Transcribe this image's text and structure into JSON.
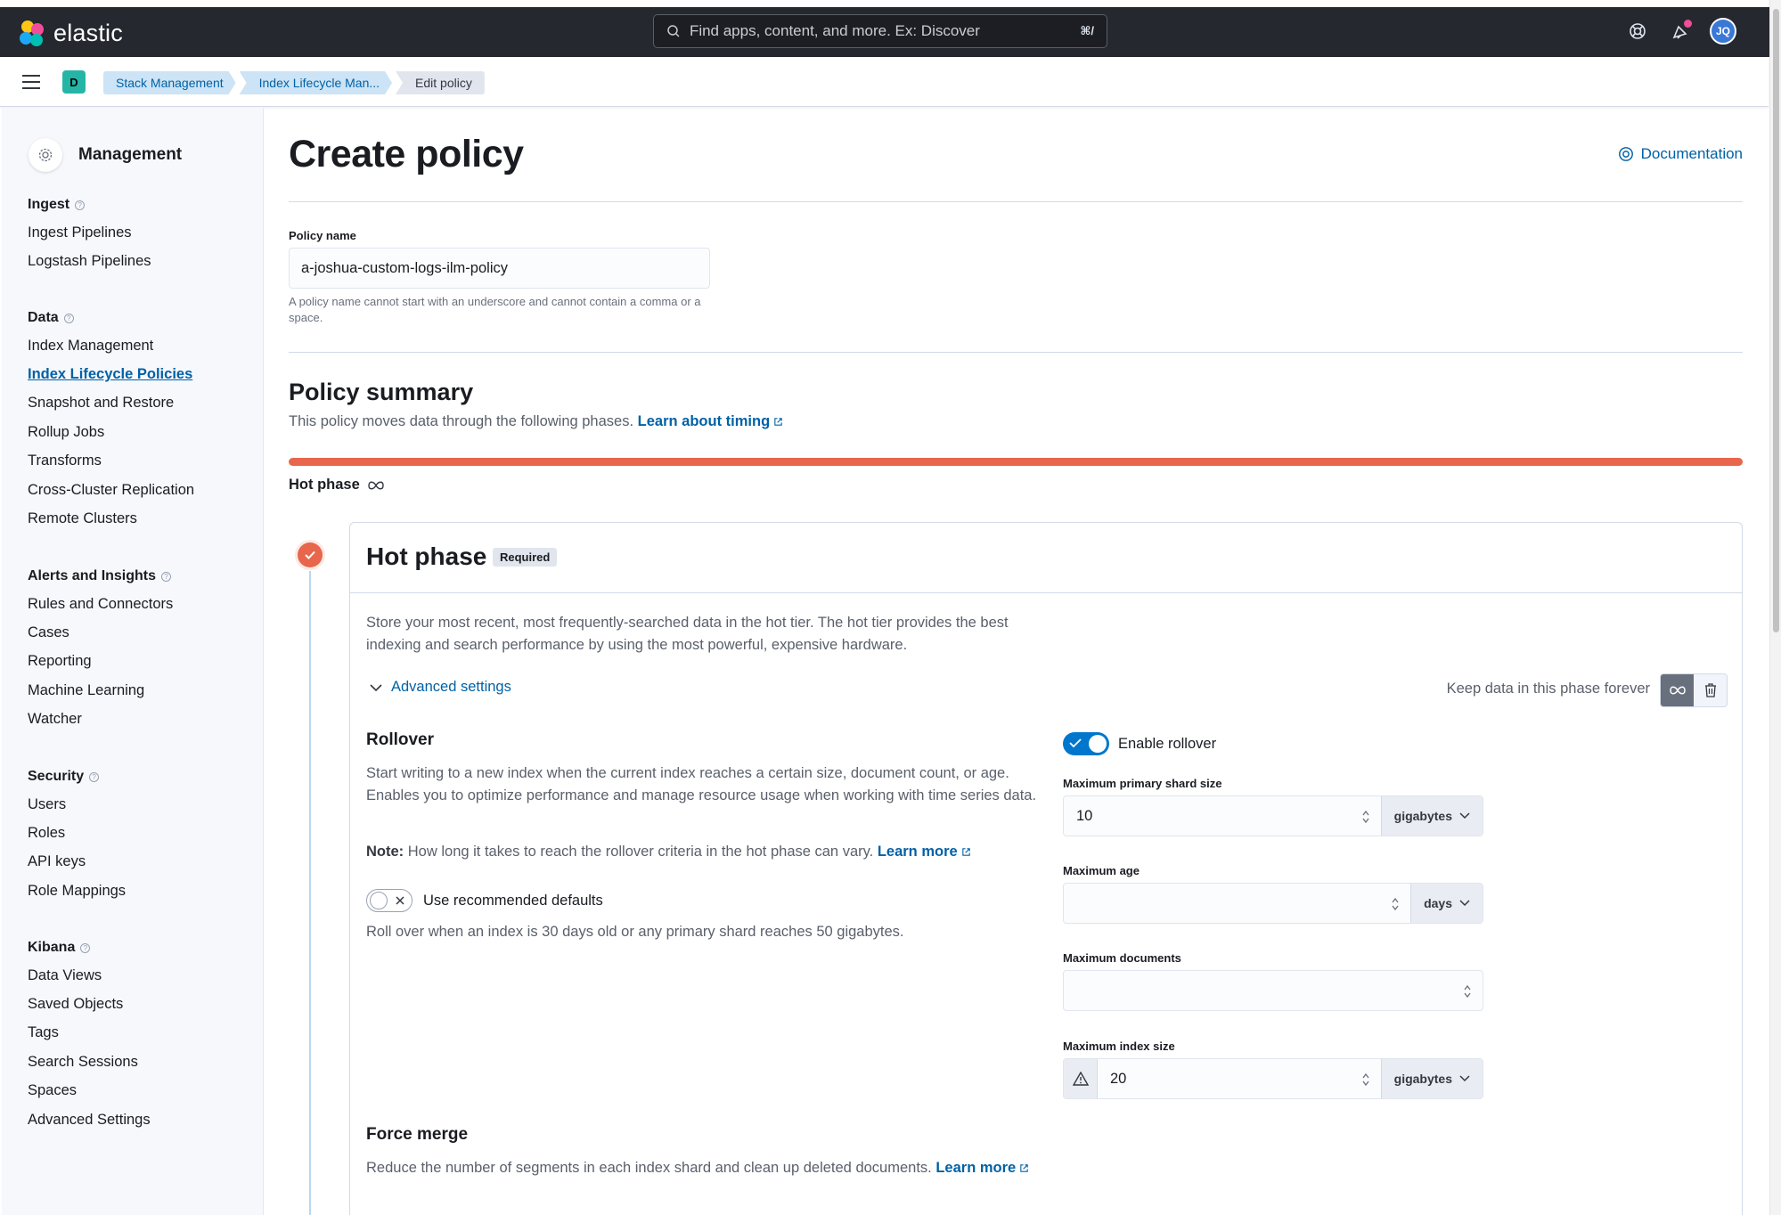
{
  "header": {
    "logo_text": "elastic",
    "search_placeholder": "Find apps, content, and more. Ex: Discover",
    "search_shortcut": "⌘/",
    "avatar_initials": "JQ"
  },
  "breadcrumbs": {
    "space_initial": "D",
    "items": [
      "Stack Management",
      "Index Lifecycle Man...",
      "Edit policy"
    ]
  },
  "sidebar": {
    "title": "Management",
    "groups": [
      {
        "title": "Ingest",
        "items": [
          "Ingest Pipelines",
          "Logstash Pipelines"
        ]
      },
      {
        "title": "Data",
        "items": [
          "Index Management",
          "Index Lifecycle Policies",
          "Snapshot and Restore",
          "Rollup Jobs",
          "Transforms",
          "Cross-Cluster Replication",
          "Remote Clusters"
        ]
      },
      {
        "title": "Alerts and Insights",
        "items": [
          "Rules and Connectors",
          "Cases",
          "Reporting",
          "Machine Learning",
          "Watcher"
        ]
      },
      {
        "title": "Security",
        "items": [
          "Users",
          "Roles",
          "API keys",
          "Role Mappings"
        ]
      },
      {
        "title": "Kibana",
        "items": [
          "Data Views",
          "Saved Objects",
          "Tags",
          "Search Sessions",
          "Spaces",
          "Advanced Settings"
        ]
      }
    ],
    "active_item": "Index Lifecycle Policies"
  },
  "main": {
    "title": "Create policy",
    "documentation": "Documentation",
    "policy_name_label": "Policy name",
    "policy_name_value": "a-joshua-custom-logs-ilm-policy",
    "policy_name_help": "A policy name cannot start with an underscore and cannot contain a comma or a space.",
    "summary_title": "Policy summary",
    "summary_text": "This policy moves data through the following phases.",
    "summary_link": "Learn about timing",
    "timeline_label": "Hot phase",
    "colors": {
      "hot": "#e7664c",
      "accent": "#0077cc"
    }
  },
  "hot_phase": {
    "title": "Hot phase",
    "badge": "Required",
    "description": "Store your most recent, most frequently-searched data in the hot tier. The hot tier provides the best indexing and search performance by using the most powerful, expensive hardware.",
    "advanced_settings": "Advanced settings",
    "keep_forever": "Keep data in this phase forever",
    "rollover": {
      "title": "Rollover",
      "description": "Start writing to a new index when the current index reaches a certain size, document count, or age. Enables you to optimize performance and manage resource usage when working with time series data.",
      "note_label": "Note:",
      "note_text": "How long it takes to reach the rollover criteria in the hot phase can vary.",
      "note_link": "Learn more",
      "use_defaults_label": "Use recommended defaults",
      "defaults_text": "Roll over when an index is 30 days old or any primary shard reaches 50 gigabytes.",
      "enable_label": "Enable rollover",
      "max_shard_label": "Maximum primary shard size",
      "max_shard_value": "10",
      "max_shard_unit": "gigabytes",
      "max_age_label": "Maximum age",
      "max_age_value": "",
      "max_age_unit": "days",
      "max_docs_label": "Maximum documents",
      "max_docs_value": "",
      "max_index_label": "Maximum index size",
      "max_index_value": "20",
      "max_index_unit": "gigabytes"
    },
    "force_merge": {
      "title": "Force merge",
      "description": "Reduce the number of segments in each index shard and clean up deleted documents.",
      "link": "Learn more"
    }
  }
}
